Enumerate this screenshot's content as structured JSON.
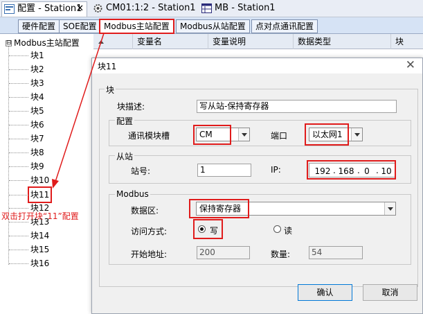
{
  "doc_tabs": [
    {
      "label": "配置 - Station1",
      "close": "✕"
    },
    {
      "label": "CM01:1:2 - Station1"
    },
    {
      "label": "MB - Station1"
    }
  ],
  "sub_tabs": [
    "硬件配置",
    "SOE配置",
    "Modbus主站配置",
    "Modbus从站配置",
    "点对点通讯配置"
  ],
  "tree": {
    "root_toggle": "⊟",
    "root": "Modbus主站配置",
    "items": [
      "块1",
      "块2",
      "块3",
      "块4",
      "块5",
      "块6",
      "块7",
      "块8",
      "块9",
      "块10",
      "块11",
      "块12",
      "块13",
      "块14",
      "块15",
      "块16"
    ]
  },
  "grid_headers": [
    "变量名",
    "变量说明",
    "数据类型",
    "块"
  ],
  "annotation": "双击打开块“11”配置",
  "dialog": {
    "title": "块11",
    "close": "✕",
    "block_group": "块",
    "desc_label": "块描述:",
    "desc_value": "写从站-保持寄存器",
    "config_group": "配置",
    "slot_label": "通讯模块槽",
    "slot_value": "CM",
    "port_label": "端口",
    "port_value": "以太网1",
    "slave_group": "从站",
    "station_label": "站号:",
    "station_value": "1",
    "ip_label": "IP:",
    "ip": [
      "192",
      "168",
      "0",
      "10"
    ],
    "ip_dot": ".",
    "modbus_group": "Modbus",
    "area_label": "数据区:",
    "area_value": "保持寄存器",
    "access_label": "访问方式:",
    "access_write": "写",
    "access_read": "读",
    "access_selected": "写",
    "start_label": "开始地址:",
    "start_value": "200",
    "count_label": "数量:",
    "count_value": "54",
    "ok": "确认",
    "cancel": "取消"
  },
  "colors": {
    "highlight": "#e01b1b",
    "tab_bar": "#d6e3f5"
  }
}
